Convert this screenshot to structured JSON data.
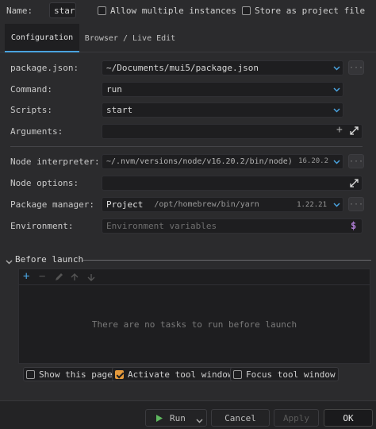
{
  "header": {
    "name_label": "Name:",
    "name_value": "star",
    "allow_multiple_label": "Allow multiple instances",
    "store_project_label": "Store as project file"
  },
  "tabs": [
    {
      "label": "Configuration",
      "active": true
    },
    {
      "label": "Browser / Live Edit",
      "active": false
    }
  ],
  "form": {
    "package_json": {
      "label": "package.json:",
      "value": "~/Documents/mui5/package.json"
    },
    "command": {
      "label": "Command:",
      "value": "run"
    },
    "scripts": {
      "label": "Scripts:",
      "value": "start"
    },
    "arguments": {
      "label": "Arguments:",
      "value": ""
    },
    "node_interpreter": {
      "label": "Node interpreter:",
      "value": "~/.nvm/versions/node/v16.20.2/bin/node)",
      "version": "16.20.2"
    },
    "node_options": {
      "label": "Node options:",
      "value": ""
    },
    "package_manager": {
      "label": "Package manager:",
      "scope": "Project",
      "path": "/opt/homebrew/bin/yarn",
      "version": "1.22.21"
    },
    "environment": {
      "label": "Environment:",
      "placeholder": "Environment variables"
    }
  },
  "before_launch": {
    "title": "Before launch",
    "empty_text": "There are no tasks to run before launch",
    "toolbar": [
      "add-icon",
      "remove-icon",
      "edit-icon",
      "move-up-icon",
      "move-down-icon"
    ]
  },
  "options": {
    "show_page": {
      "label": "Show this page",
      "checked": false
    },
    "activate_tool_window": {
      "label": "Activate tool window",
      "checked": true
    },
    "focus_tool_window": {
      "label": "Focus tool window",
      "checked": false
    }
  },
  "footer": {
    "run_label": "Run",
    "cancel_label": "Cancel",
    "apply_label": "Apply",
    "ok_label": "OK"
  },
  "colors": {
    "background": "#2b2b2d",
    "field": "#1e1e20",
    "accent": "#4aa3df",
    "checked": "#e59a3c",
    "run_icon": "#5fb85f",
    "env_icon": "#b07fd6"
  }
}
